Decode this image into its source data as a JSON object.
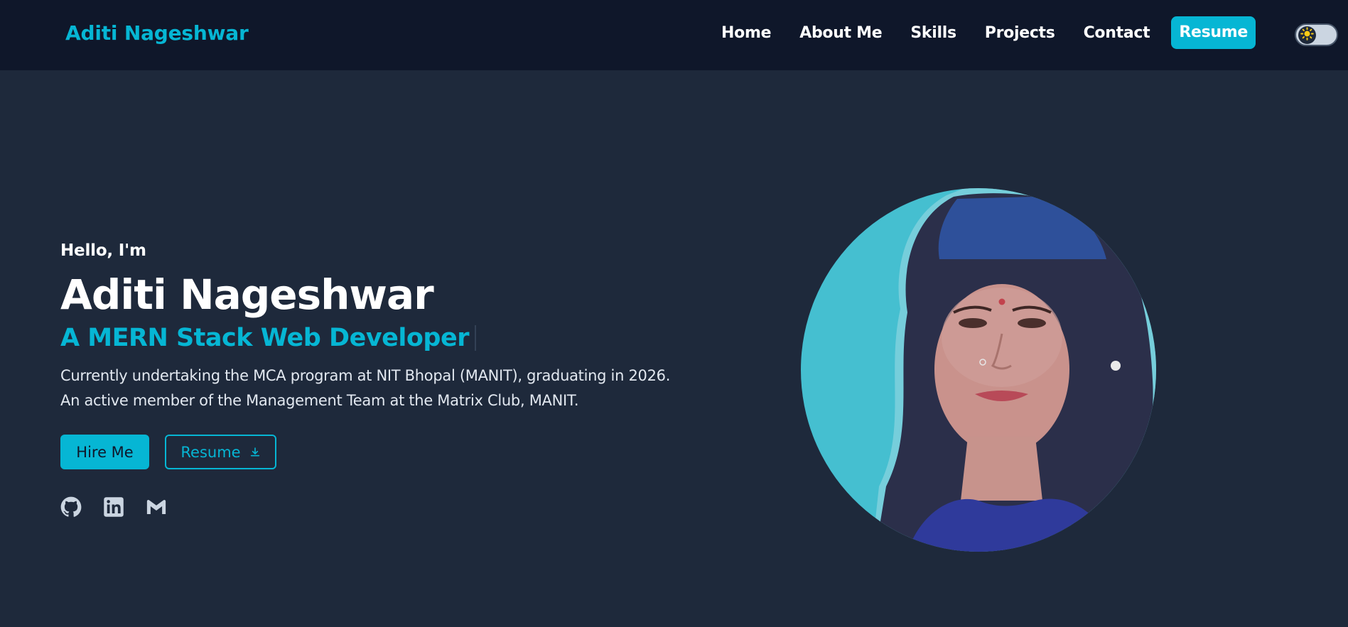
{
  "nav": {
    "brand": "Aditi Nageshwar",
    "links": [
      "Home",
      "About Me",
      "Skills",
      "Projects",
      "Contact"
    ],
    "resume_label": "Resume",
    "theme_toggle_icon": "sun-icon"
  },
  "hero": {
    "greeting": "Hello, I'm",
    "name": "Aditi Nageshwar",
    "role": "A MERN Stack Web Developer",
    "bio_line_1": "Currently undertaking the MCA program at NIT Bhopal (MANIT), graduating in 2026.",
    "bio_line_2": "An active member of the Management Team at the Matrix Club, MANIT.",
    "hire_label": "Hire Me",
    "resume_label": "Resume",
    "socials": [
      "github-icon",
      "linkedin-icon",
      "gmail-icon"
    ]
  },
  "colors": {
    "accent": "#06b6d4",
    "nav_bg": "#0f172a",
    "page_bg": "#1e293b",
    "portrait_bg": "#45bfd0"
  }
}
